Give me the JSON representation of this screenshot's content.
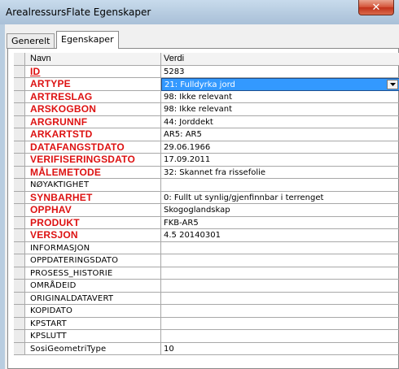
{
  "window": {
    "title": "ArealressursFlate Egenskaper",
    "close_glyph": "✕"
  },
  "tabs": [
    {
      "label": "Generelt",
      "active": false
    },
    {
      "label": "Egenskaper",
      "active": true
    }
  ],
  "grid": {
    "headers": {
      "name": "Navn",
      "value": "Verdi"
    },
    "rows": [
      {
        "name": "ID",
        "value": "5283",
        "required": true
      },
      {
        "name": "ARTYPE",
        "value": "21: Fulldyrka jord",
        "required": true,
        "selected": true
      },
      {
        "name": "ARTRESLAG",
        "value": "98: Ikke relevant",
        "required": true
      },
      {
        "name": "ARSKOGBON",
        "value": "98: Ikke relevant",
        "required": true
      },
      {
        "name": "ARGRUNNF",
        "value": "44: Jorddekt",
        "required": true
      },
      {
        "name": "ARKARTSTD",
        "value": "AR5: AR5",
        "required": true
      },
      {
        "name": "DATAFANGSTDATO",
        "value": "29.06.1966",
        "required": true
      },
      {
        "name": "VERIFISERINGSDATO",
        "value": "17.09.2011",
        "required": true
      },
      {
        "name": "MÅLEMETODE",
        "value": "32: Skannet fra rissefolie",
        "required": true
      },
      {
        "name": "NØYAKTIGHET",
        "value": "",
        "required": false
      },
      {
        "name": "SYNBARHET",
        "value": "0: Fullt ut synlig/gjenfinnbar i terrenget",
        "required": true
      },
      {
        "name": "OPPHAV",
        "value": "Skogoglandskap",
        "required": true
      },
      {
        "name": "PRODUKT",
        "value": "FKB-AR5",
        "required": true
      },
      {
        "name": "VERSJON",
        "value": "4.5 20140301",
        "required": true
      },
      {
        "name": "INFORMASJON",
        "value": "",
        "required": false
      },
      {
        "name": "OPPDATERINGSDATO",
        "value": "",
        "required": false
      },
      {
        "name": "PROSESS_HISTORIE",
        "value": "",
        "required": false
      },
      {
        "name": "OMRÅDEID",
        "value": "",
        "required": false
      },
      {
        "name": "ORIGINALDATAVERT",
        "value": "",
        "required": false
      },
      {
        "name": "KOPIDATO",
        "value": "",
        "required": false
      },
      {
        "name": "KPSTART",
        "value": "",
        "required": false
      },
      {
        "name": "KPSLUTT",
        "value": "",
        "required": false
      },
      {
        "name": "SosiGeometriType",
        "value": "10",
        "required": false
      }
    ]
  }
}
